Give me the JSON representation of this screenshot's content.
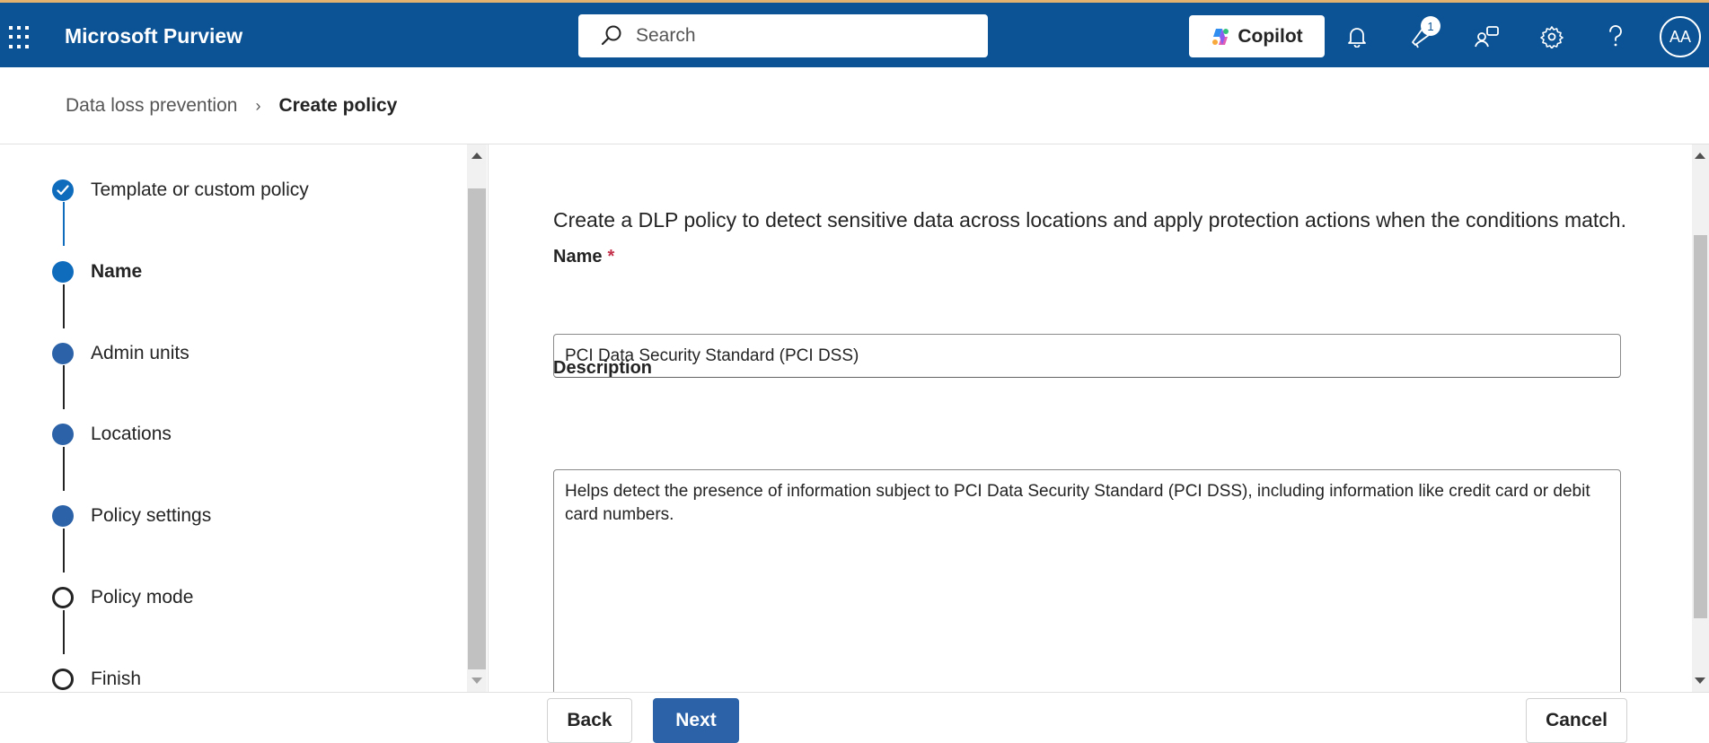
{
  "app": {
    "title": "Microsoft Purview",
    "search_placeholder": "Search",
    "copilot_label": "Copilot",
    "notification_badge": "1",
    "avatar_initials": "AA"
  },
  "breadcrumb": {
    "parent": "Data loss prevention",
    "current": "Create policy"
  },
  "steps": [
    {
      "label": "Template or custom policy",
      "state": "completed"
    },
    {
      "label": "Name",
      "state": "current"
    },
    {
      "label": "Admin units",
      "state": "upcoming"
    },
    {
      "label": "Locations",
      "state": "upcoming"
    },
    {
      "label": "Policy settings",
      "state": "upcoming"
    },
    {
      "label": "Policy mode",
      "state": "not-started"
    },
    {
      "label": "Finish",
      "state": "not-started"
    }
  ],
  "main": {
    "intro": "Create a DLP policy to detect sensitive data across locations and apply protection actions when the conditions match.",
    "name_label": "Name",
    "required_marker": "*",
    "name_value": "PCI Data Security Standard (PCI DSS)",
    "description_label": "Description",
    "description_value": "Helps detect the presence of information subject to PCI Data Security Standard (PCI DSS), including information like credit card or debit card numbers."
  },
  "footer": {
    "back_label": "Back",
    "next_label": "Next",
    "cancel_label": "Cancel"
  },
  "colors": {
    "topbar": "#0b5394",
    "accent": "#0f6cbd",
    "primary_button": "#2b62a8"
  }
}
